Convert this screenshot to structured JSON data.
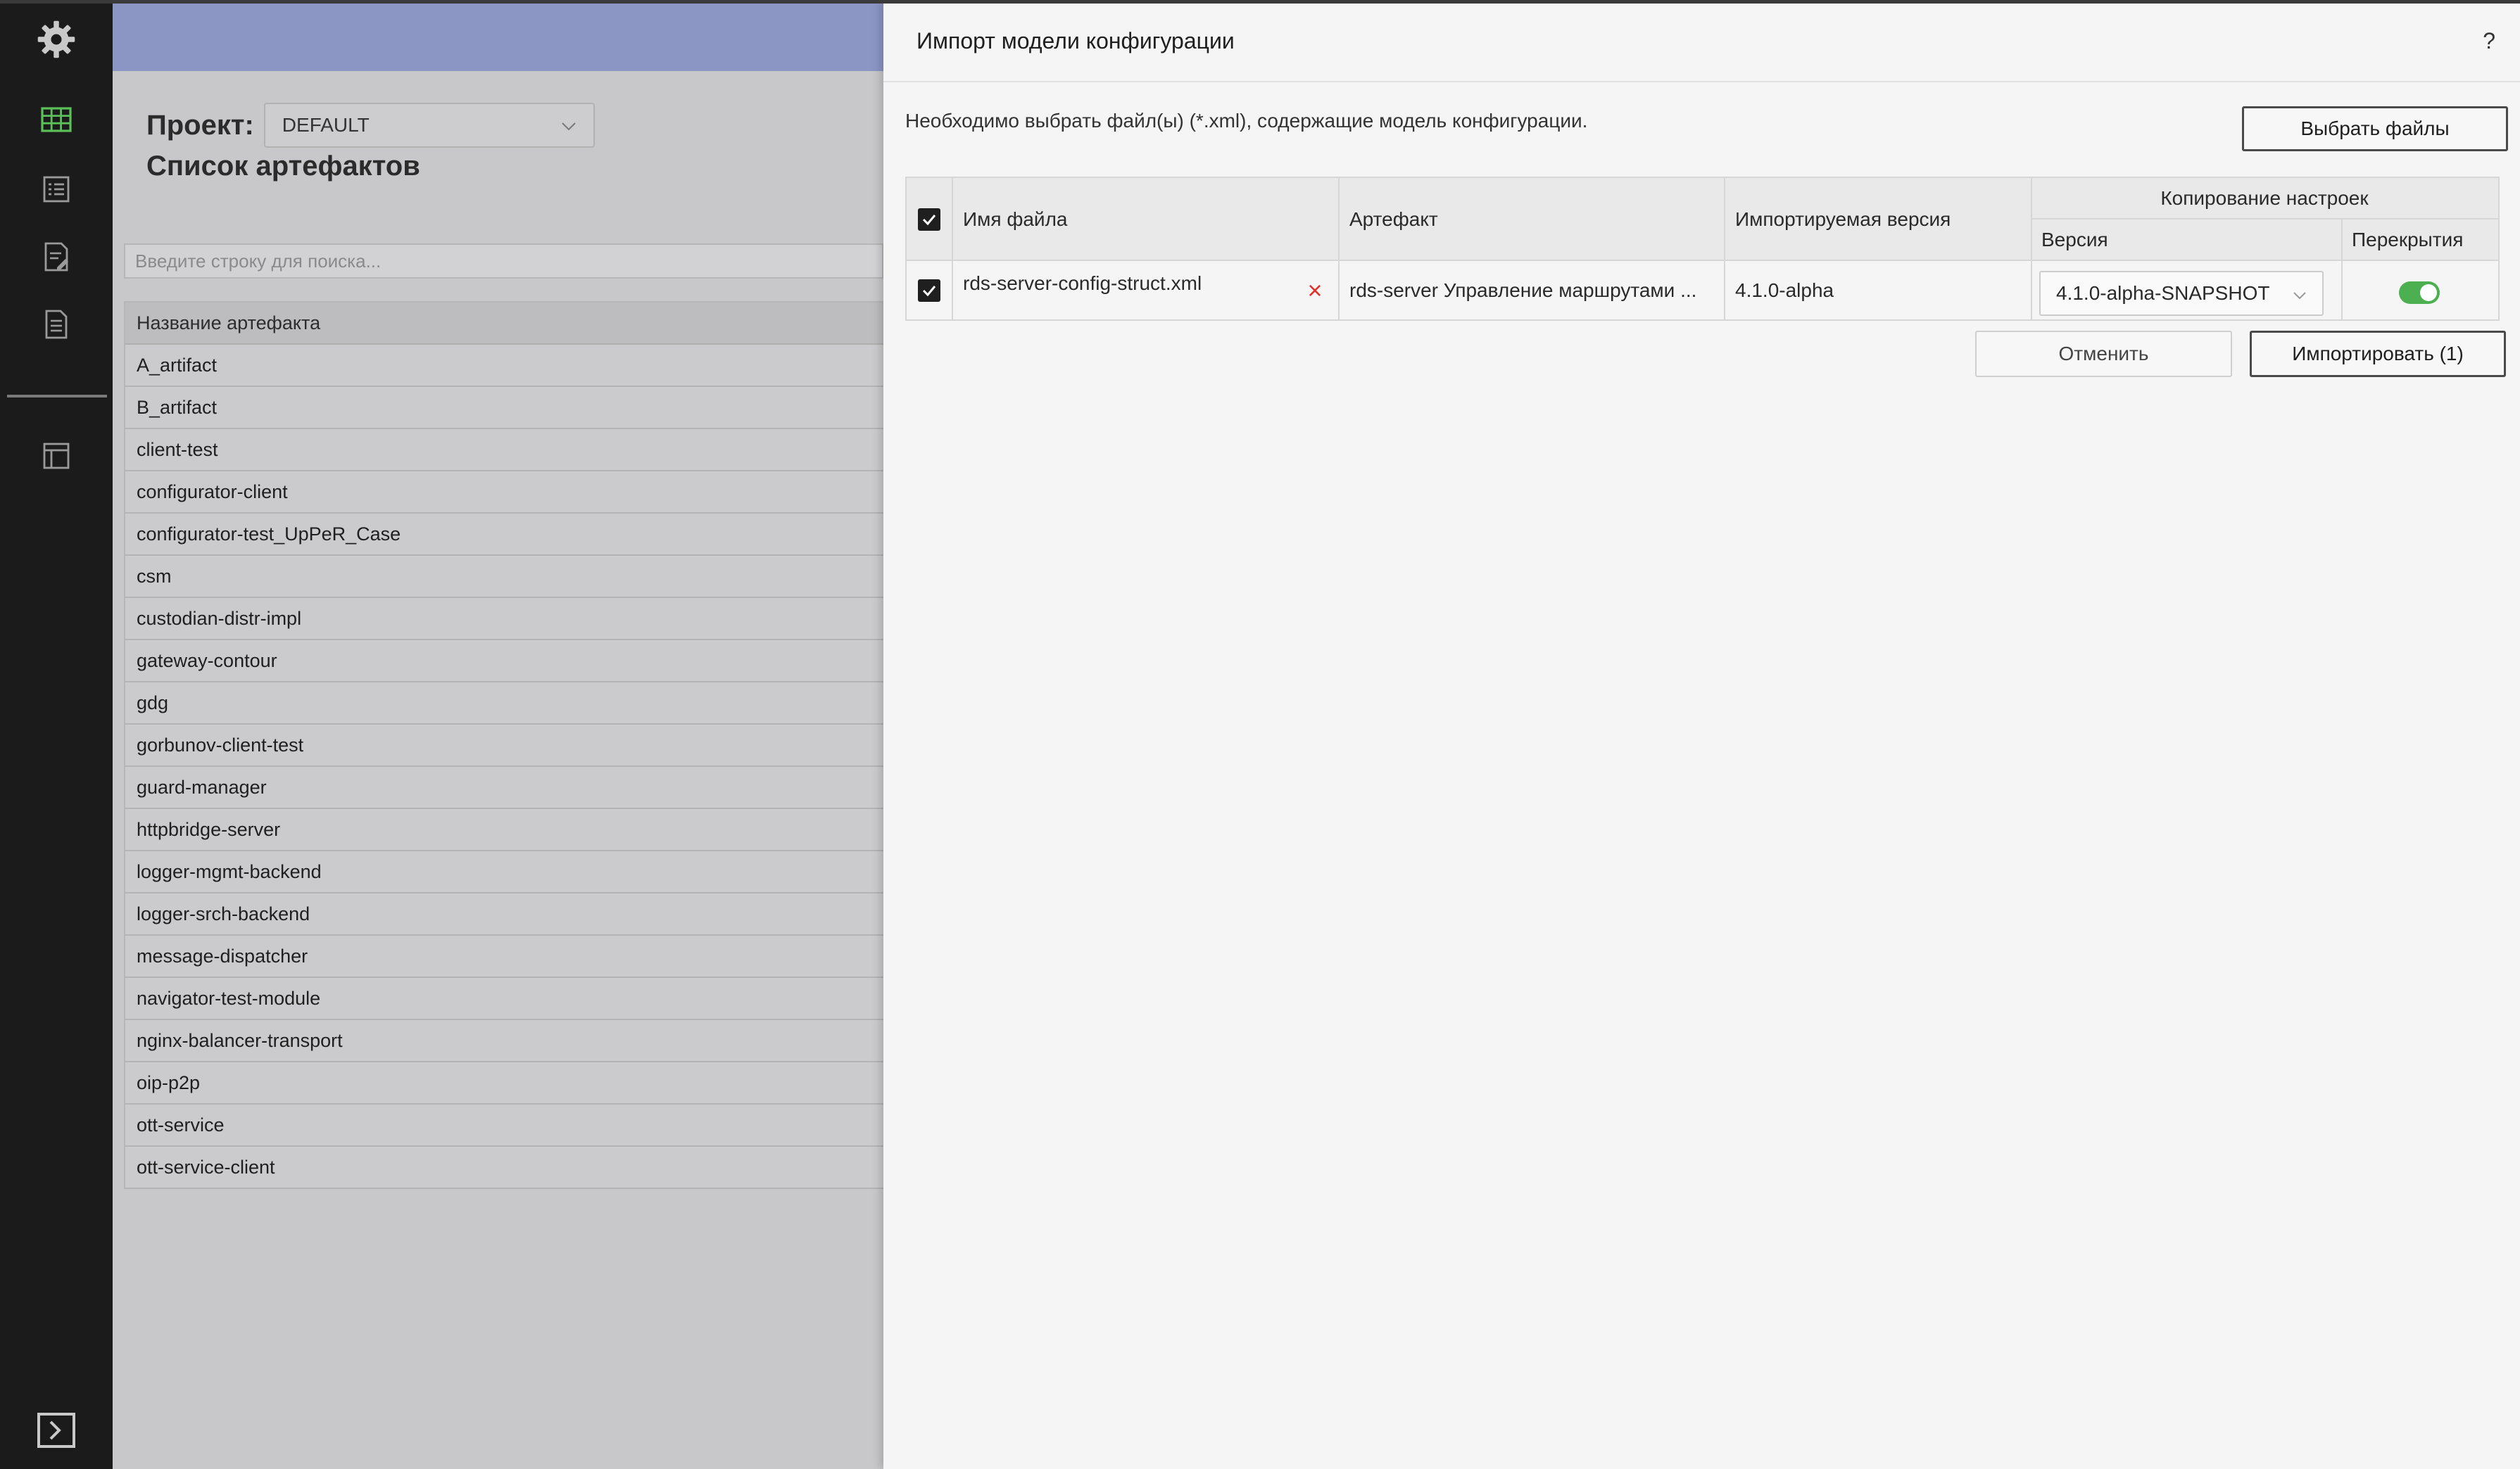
{
  "nav": {
    "icons": [
      "gear-icon",
      "table-grid-icon",
      "list-icon",
      "document-edit-icon",
      "document-list-icon",
      "layout-panel-icon",
      "expand-panel-icon"
    ]
  },
  "page": {
    "project_label": "Проект:",
    "project_value": "DEFAULT",
    "title": "Список артефактов",
    "search_placeholder": "Введите строку для поиска...",
    "table_header": "Название артефакта",
    "artifacts": [
      "A_artifact",
      "B_artifact",
      "client-test",
      "configurator-client",
      "configurator-test_UpPeR_Case",
      "csm",
      "custodian-distr-impl",
      "gateway-contour",
      "gdg",
      "gorbunov-client-test",
      "guard-manager",
      "httpbridge-server",
      "logger-mgmt-backend",
      "logger-srch-backend",
      "message-dispatcher",
      "navigator-test-module",
      "nginx-balancer-transport",
      "oip-p2p",
      "ott-service",
      "ott-service-client"
    ]
  },
  "dialog": {
    "title": "Импорт модели конфигурации",
    "help": "?",
    "instruction": "Необходимо выбрать файл(ы) (*.xml), содержащие модель конфигурации.",
    "choose_files_label": "Выбрать файлы",
    "table": {
      "headers": {
        "filename": "Имя файла",
        "artifact": "Артефакт",
        "imported_version": "Импортируемая версия",
        "copy_settings": "Копирование настроек",
        "version": "Версия",
        "overrides": "Перекрытия"
      },
      "rows": [
        {
          "filename": "rds-server-config-struct.xml",
          "remove": "×",
          "artifact": "rds-server Управление маршрутами ...",
          "imported_version": "4.1.0-alpha",
          "copy_version": "4.1.0-alpha-SNAPSHOT",
          "overrides_enabled": true
        }
      ]
    },
    "cancel_label": "Отменить",
    "import_label": "Импортировать (1)"
  },
  "colors": {
    "accent_green": "#4caf50",
    "remove_red": "#e0302a",
    "banner": "#8b96c4",
    "rail": "#1b1b1b"
  }
}
